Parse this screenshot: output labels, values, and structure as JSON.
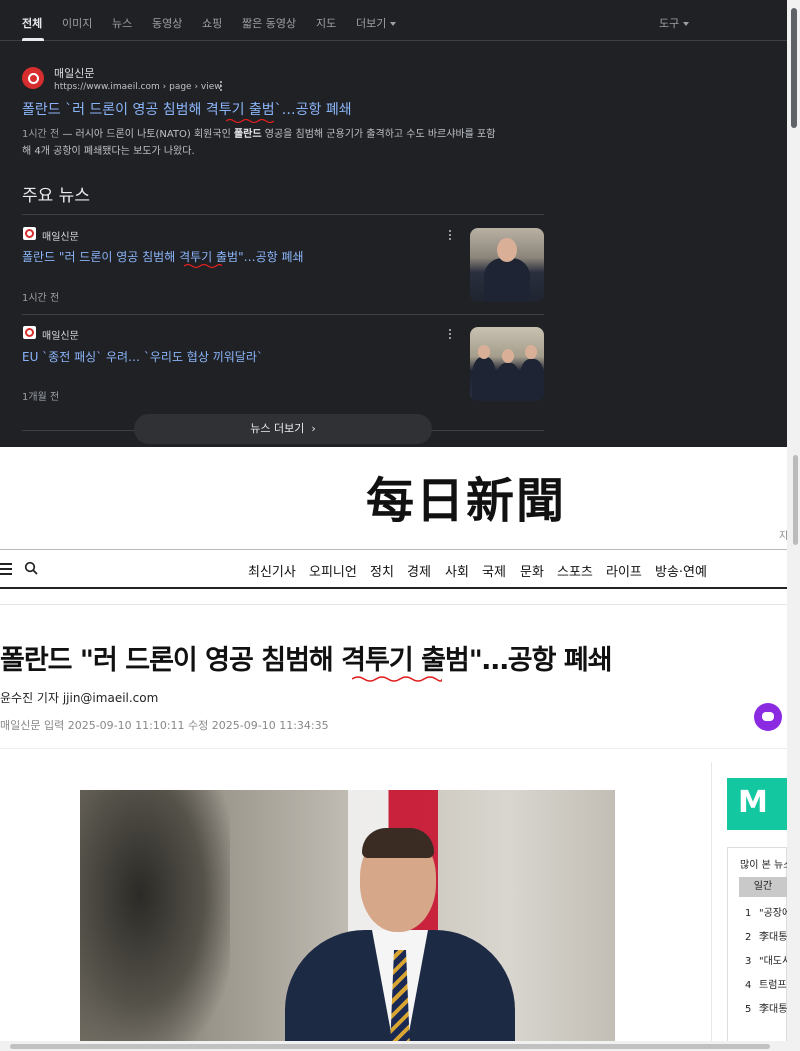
{
  "search_tabs": [
    {
      "label": "전체",
      "active": true
    },
    {
      "label": "이미지"
    },
    {
      "label": "뉴스"
    },
    {
      "label": "동영상"
    },
    {
      "label": "쇼핑"
    },
    {
      "label": "짧은 동영상"
    },
    {
      "label": "지도"
    },
    {
      "label": "더보기"
    }
  ],
  "tools_label": "도구",
  "result": {
    "site_name": "매일신문",
    "url": "https://www.imaeil.com › page › view",
    "title": "폴란드 `러 드론이 영공 침범해 격투기 출범`…공항 폐쇄",
    "snippet_time": "1시간 전",
    "snippet_line1_pre": " — 러시아 드론이 나토(NATO) 회원국인 ",
    "snippet_bold": "폴란드",
    "snippet_line1_post": " 영공을 침범해 군용기가 출격하고 수도 바르샤바를 포함",
    "snippet_line2": "해 4개 공항이 폐쇄됐다는 보도가 나왔다."
  },
  "top_news": {
    "heading": "주요 뉴스",
    "items": [
      {
        "source": "매일신문",
        "title": "폴란드 \"러 드론이 영공 침범해 격투기 출범\"…공항 폐쇄",
        "time": "1시간 전"
      },
      {
        "source": "매일신문",
        "title": "EU `종전 패싱` 우려… `우리도 협상 끼워달라`",
        "time": "1개월 전"
      }
    ],
    "more_label": "뉴스 더보기"
  },
  "article": {
    "logo_text": "每日新聞",
    "corner_text": "지면",
    "nav": [
      "최신기사",
      "오피니언",
      "정치",
      "경제",
      "사회",
      "국제",
      "문화",
      "스포츠",
      "라이프",
      "방송·연예"
    ],
    "title": "폴란드 \"러 드론이 영공 침범해 격투기 출범\"…공항 폐쇄",
    "byline": "윤수진 기자 jjin@imaeil.com",
    "source": "매일신문",
    "dates": " 입력 2025-09-10 11:10:11 수정 2025-09-10 11:34:35"
  },
  "sidebar": {
    "popular_title": "많이 본 뉴스",
    "tab_label": "일간",
    "items": [
      {
        "rank": "1",
        "text": "\"공장에"
      },
      {
        "rank": "2",
        "text": "李대통령"
      },
      {
        "rank": "3",
        "text": "\"대도서"
      },
      {
        "rank": "4",
        "text": "트럼프"
      },
      {
        "rank": "5",
        "text": "李대통령"
      }
    ]
  },
  "colors": {
    "search_bg": "#202124",
    "link_blue": "#8ab4f8",
    "brand_red": "#d62e2e",
    "spell_underline": "#e02020",
    "ad_teal": "#13c8a0",
    "ai_purple": "#8a2be2"
  },
  "icons": [
    "maeil-favicon",
    "kebab-menu-icon",
    "chevron-right-icon",
    "hamburger-icon",
    "search-icon",
    "ai-assistant-icon"
  ]
}
